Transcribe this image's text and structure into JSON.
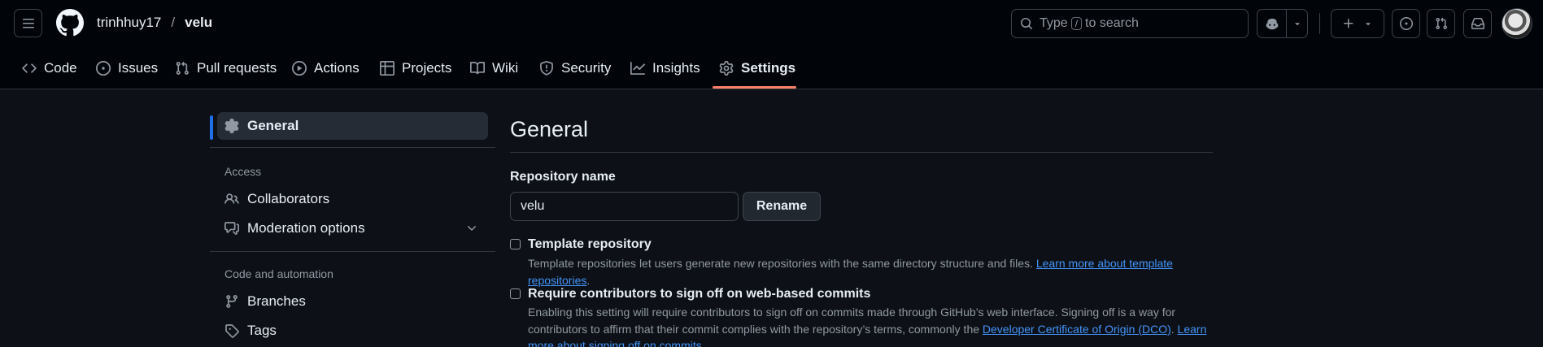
{
  "header": {
    "owner": "trinhhuy17",
    "separator": "/",
    "repo": "velu",
    "search": {
      "prefix": "Type",
      "key": "/",
      "suffix": "to search"
    }
  },
  "tabs": [
    {
      "label": "Code",
      "icon": "code-icon"
    },
    {
      "label": "Issues",
      "icon": "issue-icon"
    },
    {
      "label": "Pull requests",
      "icon": "pull-request-icon"
    },
    {
      "label": "Actions",
      "icon": "play-icon"
    },
    {
      "label": "Projects",
      "icon": "table-icon"
    },
    {
      "label": "Wiki",
      "icon": "book-icon"
    },
    {
      "label": "Security",
      "icon": "shield-icon"
    },
    {
      "label": "Insights",
      "icon": "graph-icon"
    },
    {
      "label": "Settings",
      "icon": "gear-icon",
      "active": true
    }
  ],
  "sidebar": {
    "general": "General",
    "access_heading": "Access",
    "collaborators": "Collaborators",
    "moderation": "Moderation options",
    "code_heading": "Code and automation",
    "branches": "Branches",
    "tags": "Tags"
  },
  "main": {
    "title": "General",
    "repo_name_label": "Repository name",
    "repo_name_value": "velu",
    "rename_label": "Rename",
    "template": {
      "title": "Template repository",
      "desc": "Template repositories let users generate new repositories with the same directory structure and files.",
      "link": "Learn more about template repositories",
      "after": "."
    },
    "signoff": {
      "title": "Require contributors to sign off on web-based commits",
      "desc": "Enabling this setting will require contributors to sign off on commits made through GitHub’s web interface. Signing off is a way for contributors to affirm that their commit complies with the repository’s terms, commonly the",
      "link1": "Developer Certificate of Origin (DCO)",
      "mid": ".",
      "link2": "Learn more about signing off on commits",
      "after": "."
    }
  },
  "colors": {
    "accent": "#1f6feb",
    "tab_underline": "#f78166",
    "link": "#4493f8",
    "background": "#0d1117"
  }
}
